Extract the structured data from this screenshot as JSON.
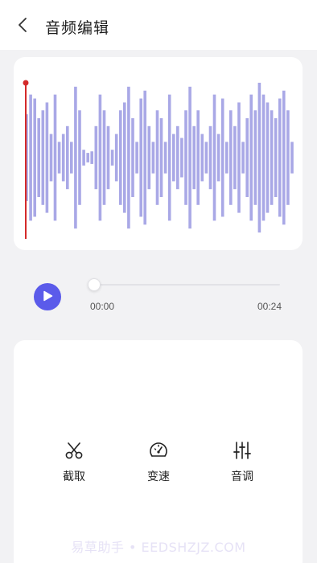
{
  "header": {
    "title": "音频编辑",
    "back_icon": "chevron-left-icon"
  },
  "waveform": {
    "bar_color": "#a9a8e6",
    "playhead_color": "#d42a2a",
    "amplitudes": [
      0.55,
      0.8,
      0.75,
      0.5,
      0.6,
      0.7,
      0.3,
      0.8,
      0.2,
      0.3,
      0.4,
      0.2,
      0.9,
      0.6,
      0.1,
      0.06,
      0.08,
      0.4,
      0.8,
      0.6,
      0.4,
      0.1,
      0.3,
      0.6,
      0.7,
      0.9,
      0.5,
      0.2,
      0.75,
      0.85,
      0.4,
      0.2,
      0.6,
      0.5,
      0.2,
      0.8,
      0.3,
      0.4,
      0.25,
      0.6,
      0.9,
      0.4,
      0.6,
      0.3,
      0.2,
      0.4,
      0.8,
      0.3,
      0.75,
      0.2,
      0.6,
      0.4,
      0.7,
      0.2,
      0.5,
      0.8,
      0.6,
      0.95,
      0.8,
      0.7,
      0.6,
      0.5,
      0.75,
      0.85,
      0.6,
      0.2
    ]
  },
  "player": {
    "play_icon": "play-icon",
    "accent_color": "#5b5bea",
    "progress": 0,
    "current_time": "00:00",
    "total_time": "00:24"
  },
  "tools": [
    {
      "label": "截取",
      "icon": "scissors-icon"
    },
    {
      "label": "变速",
      "icon": "speedometer-icon"
    },
    {
      "label": "音调",
      "icon": "sliders-icon"
    }
  ],
  "watermark": "易草助手 • EEDSHZJZ.COM"
}
